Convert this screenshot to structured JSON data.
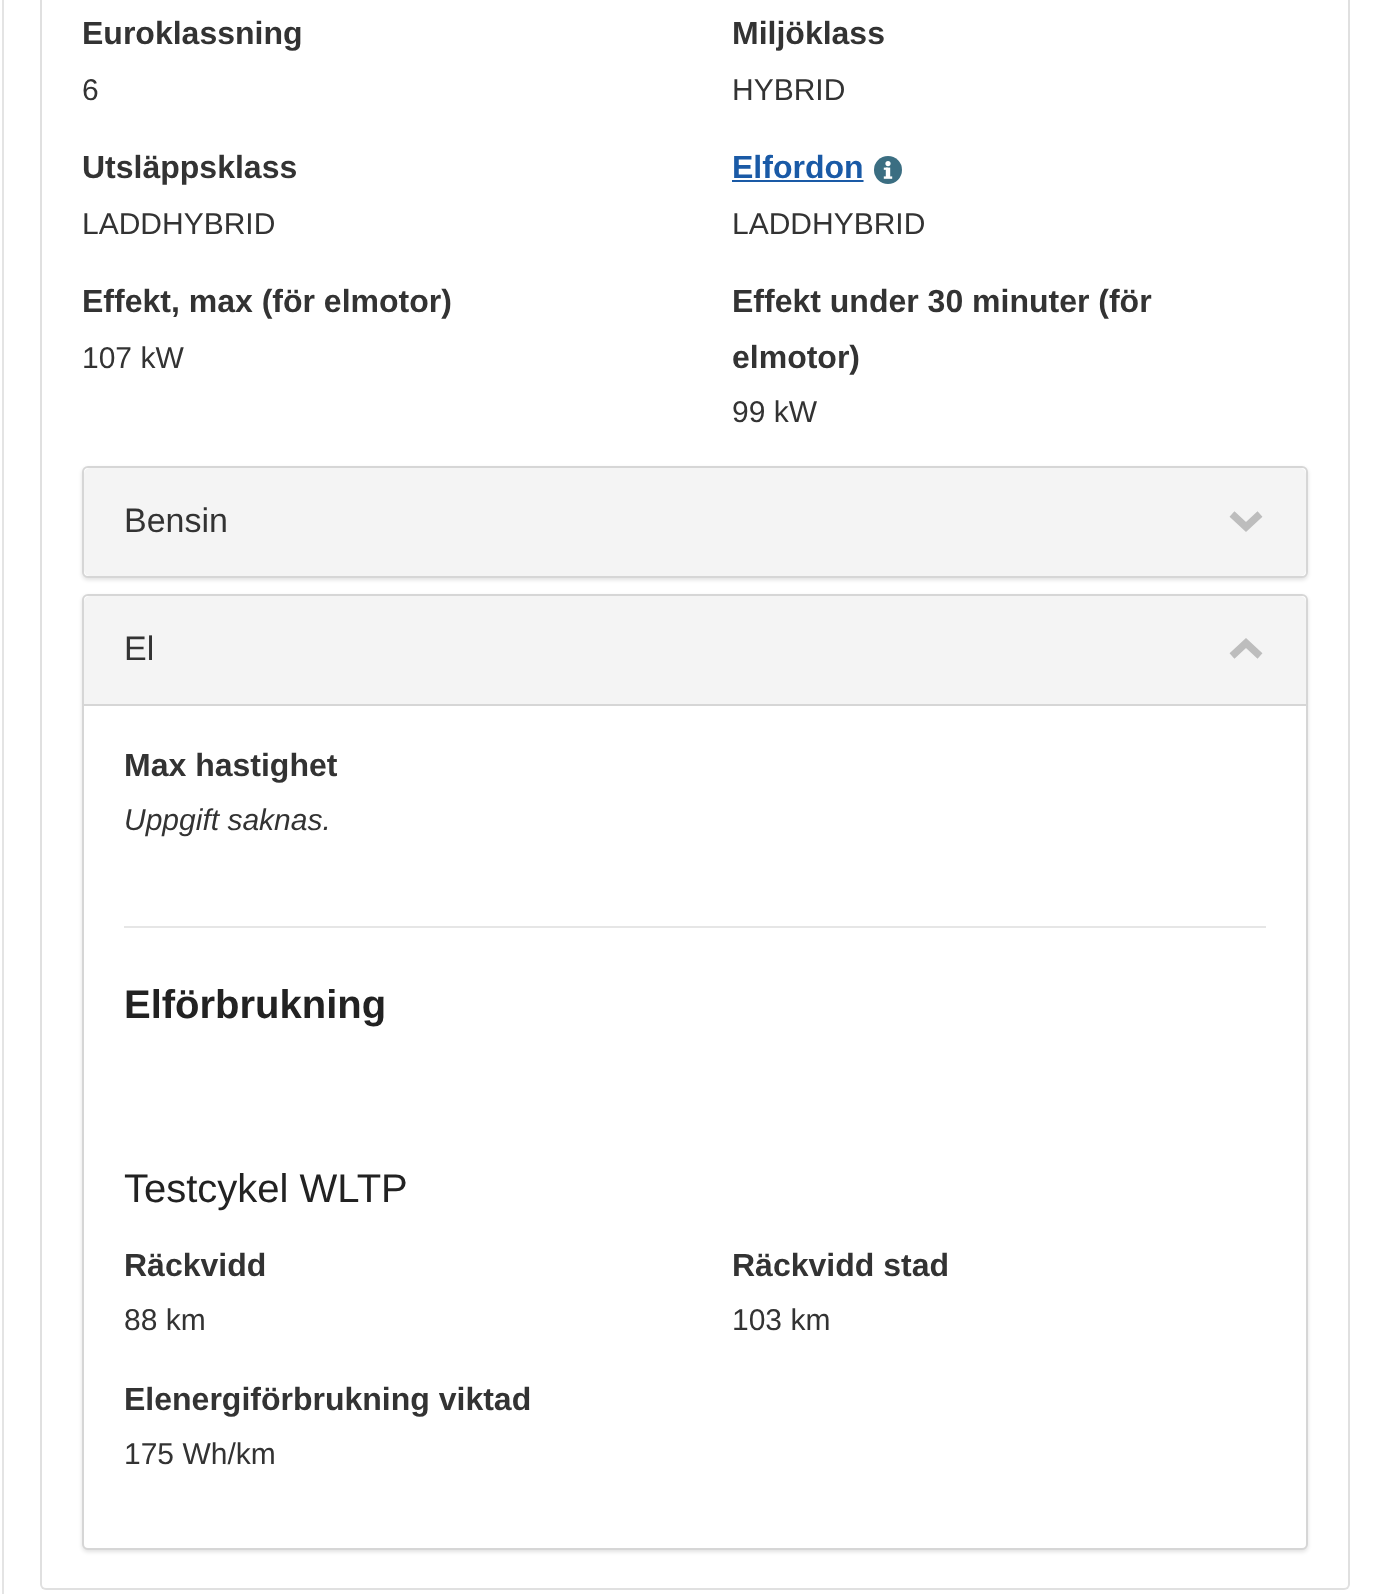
{
  "fields": [
    {
      "label": "Euroklassning",
      "value": "6",
      "kind": "plain"
    },
    {
      "label": "Miljöklass",
      "value": "HYBRID",
      "kind": "plain"
    },
    {
      "label": "Utsläppsklass",
      "value": "LADDHYBRID",
      "kind": "plain"
    },
    {
      "label": "Elfordon",
      "value": "LADDHYBRID",
      "kind": "link"
    },
    {
      "label": "Effekt, max (för elmotor)",
      "value": "107 kW",
      "kind": "plain"
    },
    {
      "label": "Effekt under 30 minuter (för elmotor)",
      "value": "99 kW",
      "kind": "plain"
    }
  ],
  "accordions": [
    {
      "title": "Bensin",
      "expanded": false
    },
    {
      "title": "El",
      "expanded": true,
      "content": {
        "fields": [
          {
            "label": "Max hastighet",
            "value": "Uppgift saknas.",
            "kind": "missing"
          }
        ],
        "section": {
          "heading": "Elförbrukning",
          "subheading": "Testcykel WLTP",
          "fields": [
            {
              "label": "Räckvidd",
              "value": "88 km",
              "kind": "plain"
            },
            {
              "label": "Räckvidd stad",
              "value": "103 km",
              "kind": "plain"
            },
            {
              "label": "Elenergiförbrukning viktad",
              "value": "175 Wh/km",
              "kind": "plain"
            }
          ]
        }
      }
    }
  ]
}
